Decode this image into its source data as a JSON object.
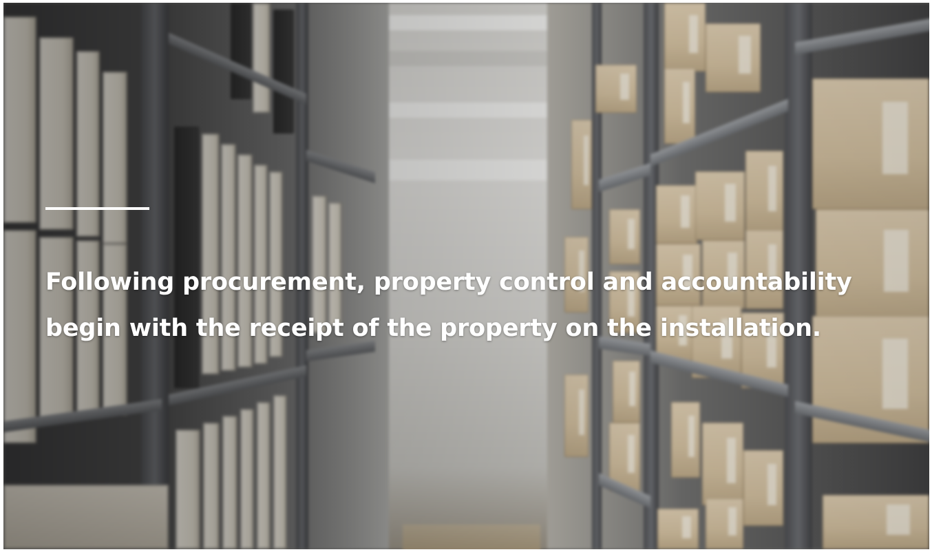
{
  "slide": {
    "quote": "Following procurement, property control and accountability begin with the receipt of the property on the installation.",
    "background_image": "archive-shelves-photo",
    "accent_color": "#ffffff"
  }
}
